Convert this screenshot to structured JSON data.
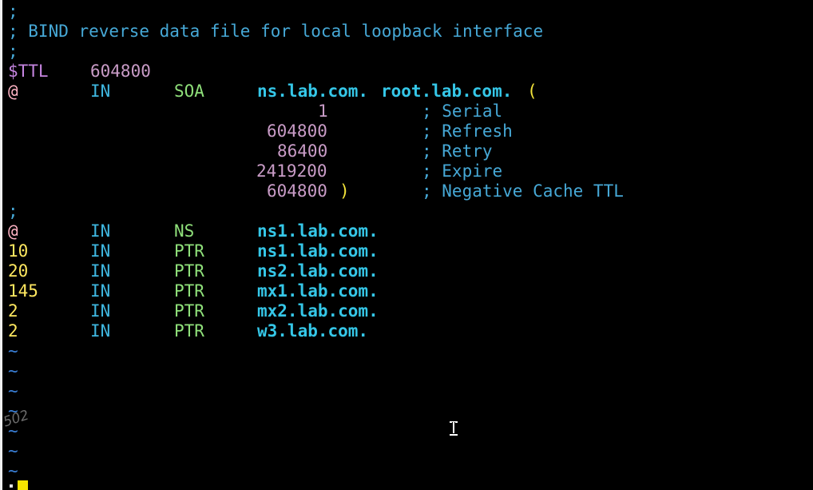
{
  "colors": {
    "background": "#000000",
    "comment": "#46a8d6",
    "number": "#c99cc7",
    "record_class": "#3fb7e0",
    "record_type": "#8fe07a",
    "hostname": "#35c7e8",
    "paren": "#f2e33a",
    "ptr_owner": "#ffe860",
    "tilde": "#3a7fd6",
    "cursor": "#f5e400"
  },
  "comments": {
    "line1": ";",
    "title": "; BIND reverse data file for local loopback interface",
    "line3": ";",
    "sep": ";"
  },
  "ttl": {
    "directive": "$TTL",
    "value": "604800"
  },
  "soa": {
    "owner": "@",
    "class": "IN",
    "type": "SOA",
    "primary_ns": "ns.lab.com.",
    "admin": "root.lab.com.",
    "open_paren": "(",
    "close_paren": ")",
    "fields": [
      {
        "value": "1",
        "comment": "; Serial"
      },
      {
        "value": "604800",
        "comment": "; Refresh"
      },
      {
        "value": "86400",
        "comment": "; Retry"
      },
      {
        "value": "2419200",
        "comment": "; Expire"
      },
      {
        "value": "604800",
        "comment": "; Negative Cache TTL"
      }
    ]
  },
  "records": [
    {
      "owner": "@",
      "class": "IN",
      "type": "NS",
      "target": "ns1.lab.com."
    },
    {
      "owner": "10",
      "class": "IN",
      "type": "PTR",
      "target": "ns1.lab.com."
    },
    {
      "owner": "20",
      "class": "IN",
      "type": "PTR",
      "target": "ns2.lab.com."
    },
    {
      "owner": "145",
      "class": "IN",
      "type": "PTR",
      "target": "mx1.lab.com."
    },
    {
      "owner": "2",
      "class": "IN",
      "type": "PTR",
      "target": "mx2.lab.com."
    },
    {
      "owner": "2",
      "class": "IN",
      "type": "PTR",
      "target": "w3.lab.com."
    }
  ],
  "empty_line_marker": "~",
  "watermark": "502"
}
